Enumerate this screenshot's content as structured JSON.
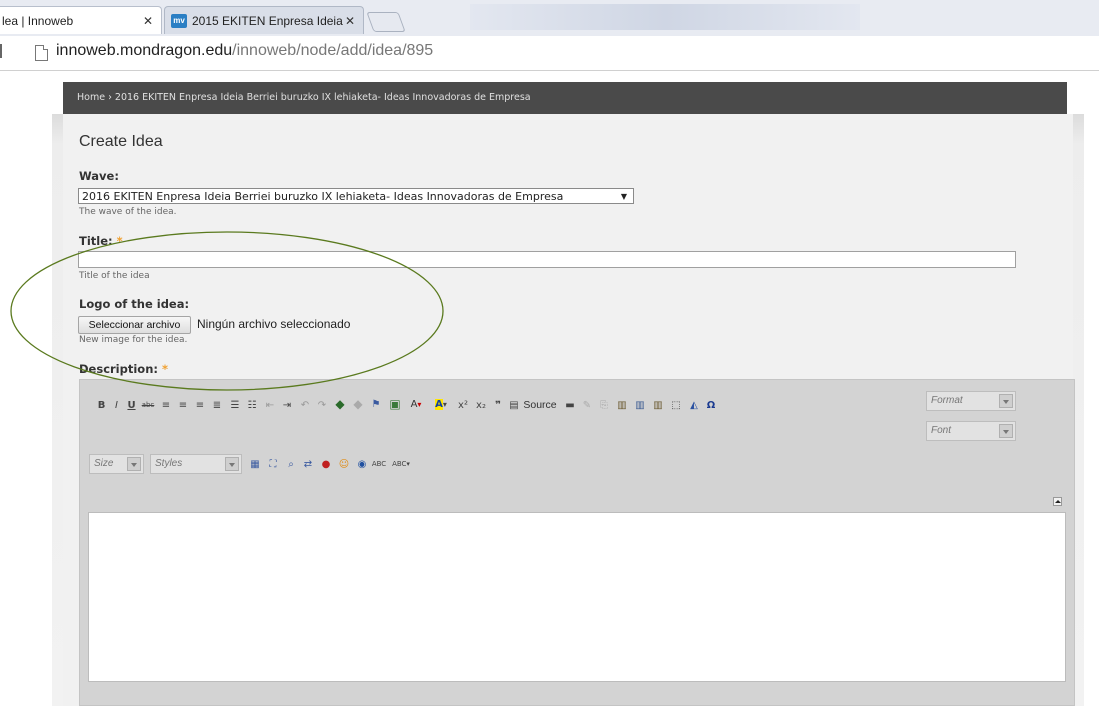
{
  "browser": {
    "tabs": [
      {
        "label": "lea | Innoweb",
        "close": "✕"
      },
      {
        "label": "2015 EKITEN Enpresa Ideia",
        "favicon": "mv",
        "close": "✕"
      }
    ],
    "url_host": "innoweb.mondragon.edu",
    "url_path": "/innoweb/node/add/idea/895"
  },
  "breadcrumb": "Home › 2016 EKITEN Enpresa Ideia Berriei buruzko IX lehiaketa- Ideas Innovadoras de Empresa",
  "page": {
    "title": "Create Idea",
    "wave": {
      "label": "Wave:",
      "value": "2016 EKITEN Enpresa Ideia Berriei buruzko IX lehiaketa- Ideas Innovadoras de Empresa",
      "description": "The wave of the idea."
    },
    "title_field": {
      "label": "Title:",
      "required": "*",
      "value": "",
      "description": "Title of the idea"
    },
    "logo": {
      "label": "Logo of the idea:",
      "button": "Seleccionar archivo",
      "status": "Ningún archivo seleccionado",
      "description": "New image for the idea."
    },
    "description_field": {
      "label": "Description:",
      "required": "*"
    }
  },
  "editor": {
    "source_label": "Source",
    "format_placeholder": "Format",
    "font_placeholder": "Font",
    "size_placeholder": "Size",
    "styles_placeholder": "Styles",
    "toolbar_row1_icons": [
      "bold-icon",
      "italic-icon",
      "underline-icon",
      "strikethrough-icon",
      "align-left-icon",
      "align-center-icon",
      "align-right-icon",
      "justify-icon",
      "bulleted-list-icon",
      "numbered-list-icon",
      "outdent-icon",
      "indent-icon",
      "undo-icon",
      "redo-icon",
      "link-icon",
      "unlink-icon",
      "anchor-icon",
      "image-icon",
      "text-color-icon",
      "background-color-icon",
      "superscript-icon",
      "subscript-icon",
      "blockquote-icon",
      "source-icon",
      "horizontal-rule-icon",
      "remove-format-icon",
      "copy-icon",
      "paste-icon",
      "paste-text-icon",
      "paste-word-icon",
      "select-all-icon",
      "eraser-icon",
      "special-char-icon"
    ],
    "toolbar_row3_icons": [
      "table-icon",
      "maximize-icon",
      "find-icon",
      "replace-icon",
      "flash-icon",
      "smiley-icon",
      "iframe-icon",
      "spellcheck-icon",
      "spellcheck-dropdown-icon"
    ]
  },
  "colors": {
    "breadcrumb_bg": "#4a4a4a",
    "required_star": "#f0a030",
    "annotation_ellipse": "#5a7a1e"
  }
}
